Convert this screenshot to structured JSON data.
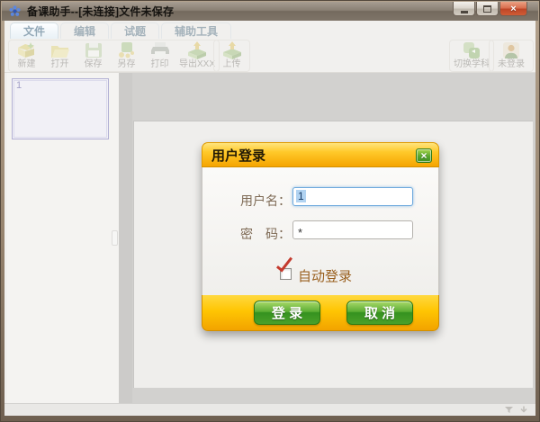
{
  "window": {
    "title": "备课助手--[未连接]文件未保存",
    "close_glyph": "×"
  },
  "tabs": [
    {
      "label": "文件",
      "active": true
    },
    {
      "label": "编辑",
      "active": false
    },
    {
      "label": "试题",
      "active": false
    },
    {
      "label": "辅助工具",
      "active": false
    }
  ],
  "toolbar": {
    "items": [
      {
        "label": "新建",
        "icon": "new-file-icon"
      },
      {
        "label": "打开",
        "icon": "open-icon"
      },
      {
        "label": "保存",
        "icon": "save-icon"
      },
      {
        "label": "另存",
        "icon": "save-as-icon"
      },
      {
        "label": "打印",
        "icon": "print-icon"
      },
      {
        "label": "导出XXX",
        "icon": "export-icon"
      },
      {
        "label": "上传",
        "icon": "upload-icon"
      }
    ],
    "right_items": [
      {
        "label": "切换学科",
        "icon": "switch-subject-icon"
      },
      {
        "label": "未登录",
        "icon": "user-icon"
      }
    ]
  },
  "sidebar": {
    "page_thumbnail_number": "1"
  },
  "statusbar": {
    "icons": [
      "funnel-icon",
      "down-arrow-icon"
    ]
  },
  "login_dialog": {
    "title": "用户登录",
    "close_glyph": "×",
    "username_label": "用户名：",
    "username_value": "1",
    "password_label": "密　码：",
    "password_value": "*",
    "auto_login_label": "自动登录",
    "auto_login_checked": true,
    "login_button": "登 录",
    "cancel_button": "取 消"
  },
  "colors": {
    "dialog_gold": "#ffc502",
    "dialog_title_gold": "#f5a400",
    "button_green": "#4aa02a",
    "close_button_green": "#5aa62e",
    "check_red": "#c43a2e",
    "selection_blue": "#b1d3f1",
    "field_label_brown": "#7e6a55",
    "auto_login_brown": "#995f1e",
    "frame_brown": "#8f7b66"
  }
}
